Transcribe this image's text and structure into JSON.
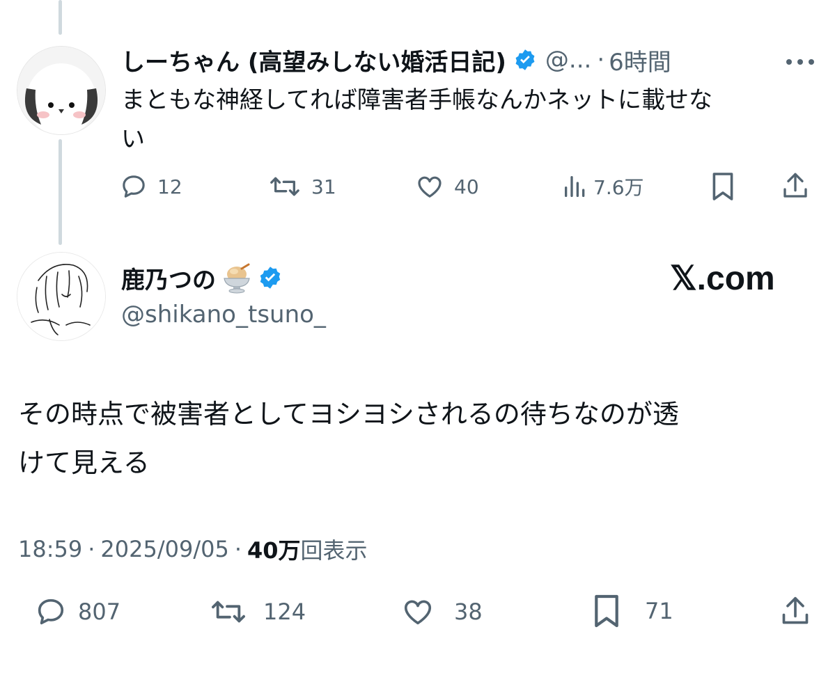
{
  "parent_tweet": {
    "display_name": "しーちゃん (高望みしない婚活日記)",
    "handle": "@...",
    "separator": "·",
    "time": "6時間",
    "more_icon": "more-dots-icon",
    "text_line1": "まともな神経してれば障害者手帳なんかネットに載せな",
    "text_line2": "い",
    "actions": {
      "replies": "12",
      "retweets": "31",
      "likes": "40",
      "views": "7.6万"
    }
  },
  "main_tweet": {
    "display_name": "鹿乃つの",
    "emoji_icon": "ice-cream-bowl-icon",
    "handle": "@shikano_tsuno_",
    "watermark": "𝕏.com",
    "text_line1": "その時点で被害者としてヨシヨシされるの待ちなのが透",
    "text_line2": "けて見える",
    "time": "18:59",
    "sep1": "·",
    "date": "2025/09/05",
    "sep2": "·",
    "view_count": "40万",
    "view_label": "回表示",
    "actions": {
      "replies": "807",
      "retweets": "124",
      "likes": "38",
      "bookmarks": "71"
    }
  },
  "colors": {
    "text": "#0f1419",
    "muted": "#536471",
    "verified": "#1d9bf0",
    "thread_line": "#cfd9de"
  }
}
